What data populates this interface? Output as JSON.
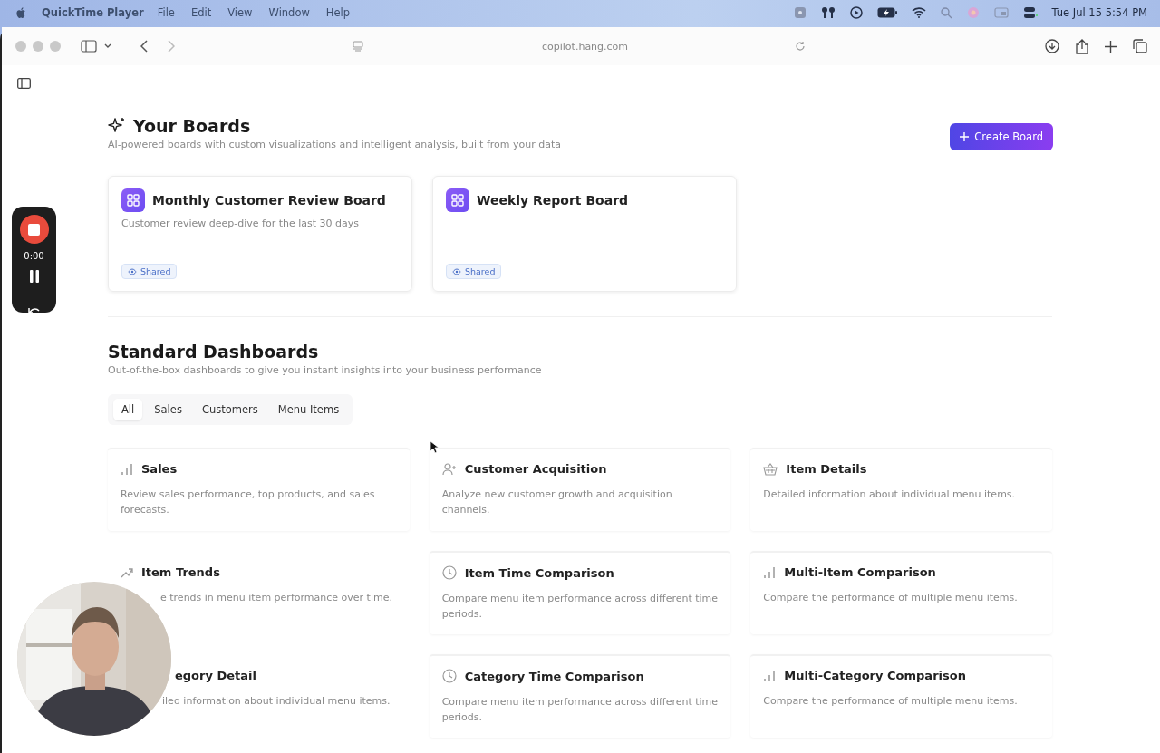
{
  "menu_bar": {
    "app": "QuickTime Player",
    "menus": [
      "File",
      "Edit",
      "View",
      "Window",
      "Help"
    ],
    "clock": "Tue Jul 15  5:54 PM"
  },
  "browser": {
    "address": "copilot.hang.com"
  },
  "recorder": {
    "time": "0:00"
  },
  "boards": {
    "title": "Your Boards",
    "subtitle": "AI-powered boards with custom visualizations and intelligent analysis, built from your data",
    "create_button": "Create Board",
    "items": [
      {
        "title": "Monthly Customer Review Board",
        "description": "Customer review deep-dive for the last 30 days",
        "badge": "Shared"
      },
      {
        "title": "Weekly Report Board",
        "badge": "Shared"
      }
    ]
  },
  "dashboards": {
    "title": "Standard Dashboards",
    "subtitle": "Out-of-the-box dashboards to give you instant insights into your business performance",
    "tabs": [
      {
        "label": "All",
        "selected": true
      },
      {
        "label": "Sales",
        "selected": false
      },
      {
        "label": "Customers",
        "selected": false
      },
      {
        "label": "Menu Items",
        "selected": false
      }
    ],
    "items": [
      {
        "title": "Sales",
        "description": "Review sales performance, top products, and sales forecasts."
      },
      {
        "title": "Customer Acquisition",
        "description": "Analyze new customer growth and acquisition channels."
      },
      {
        "title": "Item Details",
        "description": "Detailed information about individual menu items."
      },
      {
        "title": "Item Trends",
        "description": "e trends in menu item performance over time."
      },
      {
        "title": "Item Time Comparison",
        "description": "Compare menu item performance across different time periods."
      },
      {
        "title": "Multi-Item Comparison",
        "description": "Compare the performance of multiple menu items."
      },
      {
        "title": "egory Detail",
        "description": "iled information about individual menu items."
      },
      {
        "title": "Category Time Comparison",
        "description": "Compare menu item performance across different time periods."
      },
      {
        "title": "Multi-Category Comparison",
        "description": "Compare the performance of multiple menu items."
      }
    ]
  }
}
